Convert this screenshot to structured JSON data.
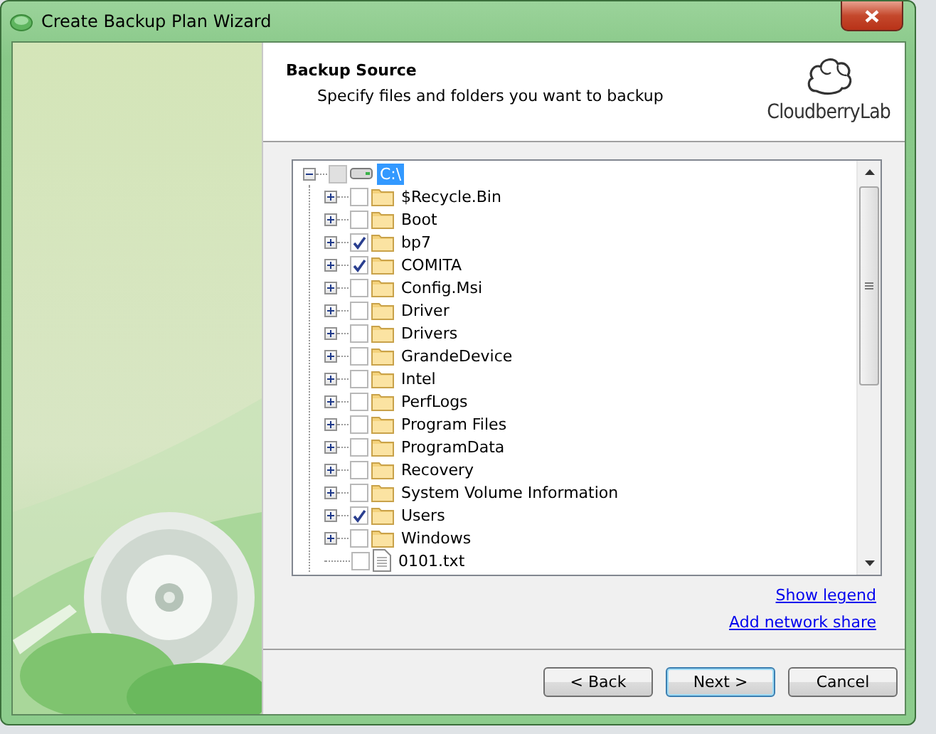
{
  "window": {
    "title": "Create Backup Plan Wizard"
  },
  "header": {
    "title": "Backup Source",
    "subtitle": "Specify files and folders you want to backup",
    "logo_text": "CloudberryLab"
  },
  "left_panel": {
    "kind": "picture"
  },
  "tree": {
    "items": [
      {
        "label": "C:\\",
        "kind": "drive",
        "expanded": true,
        "selected": true,
        "checked": false,
        "partial": true,
        "children": [
          {
            "label": "$Recycle.Bin",
            "kind": "folder",
            "expanded": false,
            "selected": false,
            "checked": false
          },
          {
            "label": "Boot",
            "kind": "folder",
            "expanded": false,
            "selected": false,
            "checked": false
          },
          {
            "label": "bp7",
            "kind": "folder",
            "expanded": false,
            "selected": false,
            "checked": true
          },
          {
            "label": "COMITA",
            "kind": "folder",
            "expanded": false,
            "selected": false,
            "checked": true
          },
          {
            "label": "Config.Msi",
            "kind": "folder",
            "expanded": false,
            "selected": false,
            "checked": false
          },
          {
            "label": "Driver",
            "kind": "folder",
            "expanded": false,
            "selected": false,
            "checked": false
          },
          {
            "label": "Drivers",
            "kind": "folder",
            "expanded": false,
            "selected": false,
            "checked": false
          },
          {
            "label": "GrandeDevice",
            "kind": "folder",
            "expanded": false,
            "selected": false,
            "checked": false
          },
          {
            "label": "Intel",
            "kind": "folder",
            "expanded": false,
            "selected": false,
            "checked": false
          },
          {
            "label": "PerfLogs",
            "kind": "folder",
            "expanded": false,
            "selected": false,
            "checked": false
          },
          {
            "label": "Program Files",
            "kind": "folder",
            "expanded": false,
            "selected": false,
            "checked": false
          },
          {
            "label": "ProgramData",
            "kind": "folder",
            "expanded": false,
            "selected": false,
            "checked": false
          },
          {
            "label": "Recovery",
            "kind": "folder",
            "expanded": false,
            "selected": false,
            "checked": false
          },
          {
            "label": "System Volume Information",
            "kind": "folder",
            "expanded": false,
            "selected": false,
            "checked": false
          },
          {
            "label": "Users",
            "kind": "folder",
            "expanded": false,
            "selected": false,
            "checked": true
          },
          {
            "label": "Windows",
            "kind": "folder",
            "expanded": false,
            "selected": false,
            "checked": false
          },
          {
            "label": "0101.txt",
            "kind": "file",
            "selected": false,
            "checked": false
          }
        ]
      }
    ]
  },
  "links": [
    "Show legend",
    "Add network share"
  ],
  "buttons": [
    {
      "label": "< Back",
      "default": false
    },
    {
      "label": "Next >",
      "default": true
    },
    {
      "label": "Cancel",
      "default": false
    }
  ]
}
